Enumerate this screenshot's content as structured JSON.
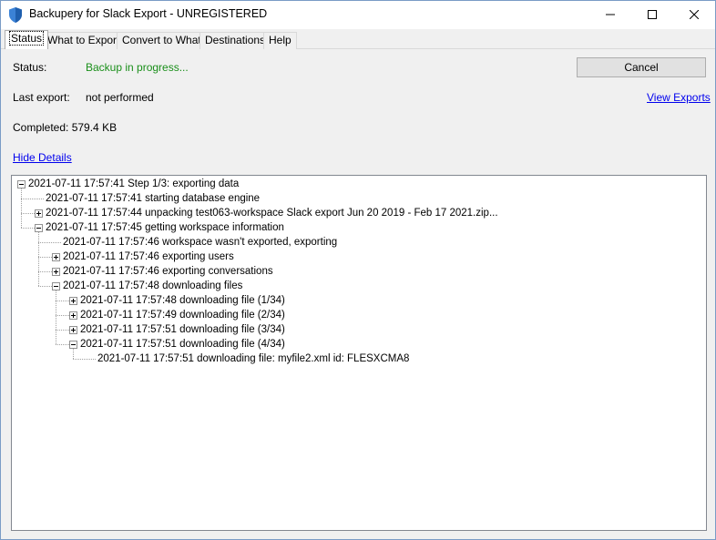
{
  "window": {
    "title": "Backupery for Slack Export - UNREGISTERED"
  },
  "tabs": [
    {
      "label": "Status"
    },
    {
      "label": "What to Export"
    },
    {
      "label": "Convert to What"
    },
    {
      "label": "Destinations"
    },
    {
      "label": "Help"
    }
  ],
  "status": {
    "label": "Status:",
    "value": "Backup in progress...",
    "cancel_label": "Cancel",
    "last_export_label": "Last export:",
    "last_export_value": "not performed",
    "view_exports_label": "View Exports",
    "completed": "Completed: 579.4 KB",
    "hide_details_label": "Hide Details"
  },
  "log": [
    {
      "text": "2021-07-11 17:57:41 Step 1/3: exporting data",
      "level": 0,
      "expander": "minus"
    },
    {
      "text": "2021-07-11 17:57:41 starting database engine",
      "level": 1,
      "expander": "none"
    },
    {
      "text": "2021-07-11 17:57:44 unpacking test063-workspace Slack export Jun 20 2019 - Feb 17 2021.zip...",
      "level": 1,
      "expander": "plus"
    },
    {
      "text": "2021-07-11 17:57:45 getting workspace information",
      "level": 1,
      "expander": "minus"
    },
    {
      "text": "2021-07-11 17:57:46 workspace wasn't exported, exporting",
      "level": 2,
      "expander": "none"
    },
    {
      "text": "2021-07-11 17:57:46 exporting users",
      "level": 2,
      "expander": "plus"
    },
    {
      "text": "2021-07-11 17:57:46 exporting conversations",
      "level": 2,
      "expander": "plus"
    },
    {
      "text": "2021-07-11 17:57:48 downloading files",
      "level": 2,
      "expander": "minus"
    },
    {
      "text": "2021-07-11 17:57:48 downloading file (1/34)",
      "level": 3,
      "expander": "plus"
    },
    {
      "text": "2021-07-11 17:57:49 downloading file (2/34)",
      "level": 3,
      "expander": "plus"
    },
    {
      "text": "2021-07-11 17:57:51 downloading file (3/34)",
      "level": 3,
      "expander": "plus"
    },
    {
      "text": "2021-07-11 17:57:51 downloading file (4/34)",
      "level": 3,
      "expander": "minus"
    },
    {
      "text": "2021-07-11 17:57:51 downloading file: myfile2.xml id: FLESXCMA8",
      "level": 4,
      "expander": "none"
    }
  ],
  "colors": {
    "status_green": "#1a8f1a",
    "link_blue": "#0000ee",
    "accent_shield": "#3b82d6"
  },
  "icons": {
    "app": "shield-icon",
    "minimize": "minimize-icon",
    "maximize": "maximize-icon",
    "close": "close-icon"
  }
}
